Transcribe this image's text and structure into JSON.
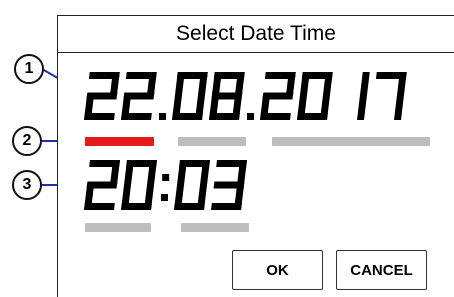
{
  "dialog": {
    "title": "Select Date Time",
    "date_display": "22.08.2017",
    "time_display": "20:03",
    "ok_label": "OK",
    "cancel_label": "CANCEL"
  },
  "field_indicators": {
    "active_color": "#e31b1b",
    "inactive_color": "#bdbdbd",
    "date": [
      "active",
      "inactive",
      "inactive"
    ],
    "time": [
      "inactive",
      "inactive"
    ]
  },
  "callouts": [
    "1",
    "2",
    "3"
  ]
}
